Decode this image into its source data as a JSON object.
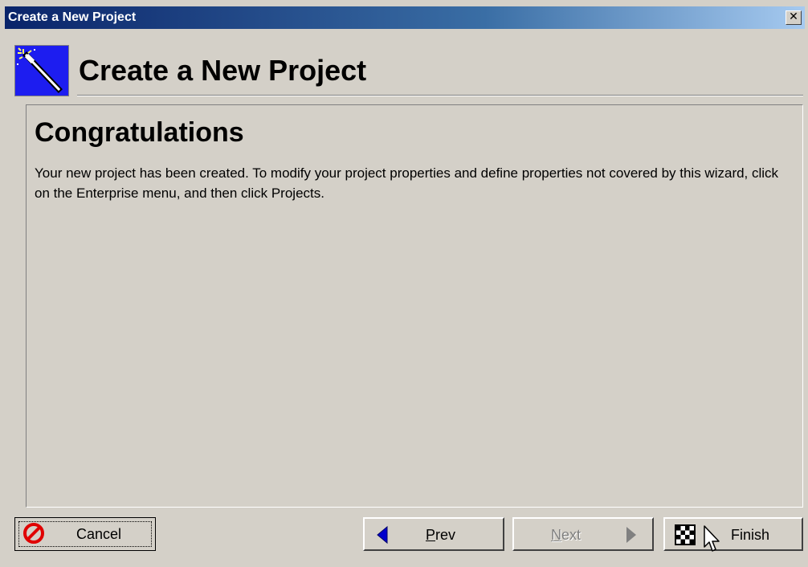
{
  "window": {
    "title": "Create a New Project",
    "close_glyph": "✕"
  },
  "header": {
    "title": "Create a New Project",
    "icon": "magic-wand-icon"
  },
  "content": {
    "heading": "Congratulations",
    "body": "Your new project has been created.  To modify your project properties and define properties not covered by this wizard, click on the Enterprise menu, and then click Projects."
  },
  "buttons": {
    "cancel": {
      "label": "Cancel",
      "icon": "cancel-icon"
    },
    "prev": {
      "mnemonic": "P",
      "rest": "rev",
      "icon": "arrow-left-icon"
    },
    "next": {
      "mnemonic": "N",
      "rest": "ext",
      "icon": "arrow-right-icon"
    },
    "finish": {
      "label": "Finish",
      "icon": "checkered-flag-icon"
    }
  },
  "colors": {
    "titlebar_start": "#0a246a",
    "titlebar_end": "#a6caf0",
    "dialog_bg": "#d4d0c8",
    "icon_bg": "#1d1df0",
    "arrow_blue": "#0000cc",
    "cancel_red": "#e00000",
    "disabled_text": "#808080"
  }
}
